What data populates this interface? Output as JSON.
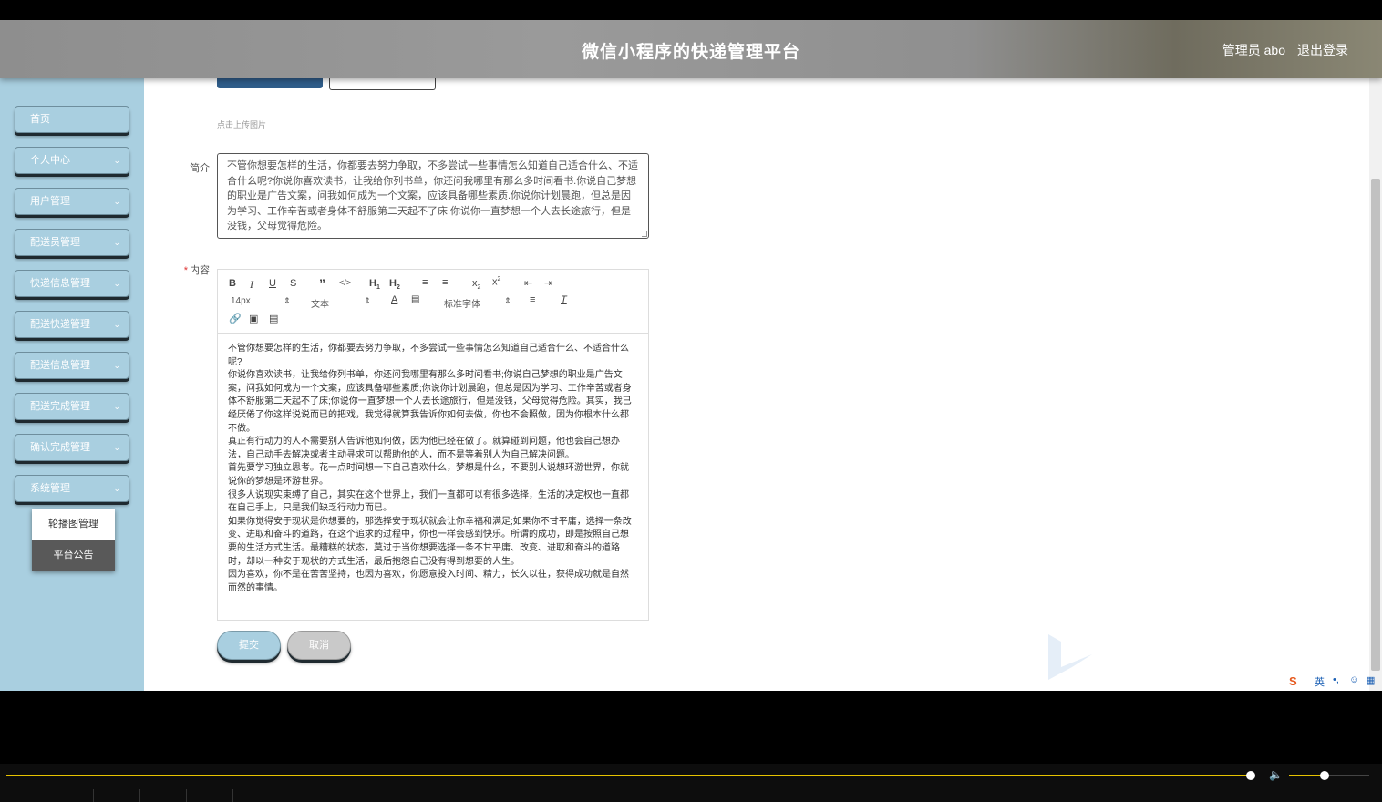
{
  "header": {
    "title": "微信小程序的快递管理平台",
    "user": "管理员 abo",
    "logout": "退出登录"
  },
  "sidebar": {
    "items": [
      {
        "label": "首页",
        "has_children": false
      },
      {
        "label": "个人中心",
        "has_children": true
      },
      {
        "label": "用户管理",
        "has_children": true
      },
      {
        "label": "配送员管理",
        "has_children": true
      },
      {
        "label": "快递信息管理",
        "has_children": true
      },
      {
        "label": "配送快递管理",
        "has_children": true
      },
      {
        "label": "配送信息管理",
        "has_children": true
      },
      {
        "label": "配送完成管理",
        "has_children": true
      },
      {
        "label": "确认完成管理",
        "has_children": true
      },
      {
        "label": "系统管理",
        "has_children": true
      }
    ],
    "submenu": [
      "轮播图管理",
      "平台公告"
    ],
    "submenu_active": "平台公告"
  },
  "form": {
    "upload_hint": "点击上传图片",
    "intro_label": "简介",
    "intro_text": "不管你想要怎样的生活，你都要去努力争取，不多尝试一些事情怎么知道自己适合什么、不适合什么呢?你说你喜欢读书，让我给你列书单，你还问我哪里有那么多时间看书.你说自己梦想的职业是广告文案，问我如何成为一个文案，应该具备哪些素质.你说你计划晨跑，但总是因为学习、工作辛苦或者身体不舒服第二天起不了床.你说你一直梦想一个人去长途旅行，但是没钱，父母觉得危险。",
    "content_label": "内容",
    "required_mark": "*",
    "toolbar": {
      "font_size": "14px",
      "block_type": "文本",
      "font_family": "标准字体"
    },
    "content_paragraphs": [
      "不管你想要怎样的生活，你都要去努力争取，不多尝试一些事情怎么知道自己适合什么、不适合什么呢?",
      "你说你喜欢读书，让我给你列书单，你还问我哪里有那么多时间看书;你说自己梦想的职业是广告文案，问我如何成为一个文案，应该具备哪些素质;你说你计划晨跑，但总是因为学习、工作辛苦或者身体不舒服第二天起不了床;你说你一直梦想一个人去长途旅行，但是没钱，父母觉得危险。其实，我已经厌倦了你这样说说而已的把戏，我觉得就算我告诉你如何去做，你也不会照做，因为你根本什么都不做。",
      "真正有行动力的人不需要别人告诉他如何做，因为他已经在做了。就算碰到问题，他也会自己想办法，自己动手去解决或者主动寻求可以帮助他的人，而不是等着别人为自己解决问题。",
      "首先要学习独立思考。花一点时间想一下自己喜欢什么，梦想是什么，不要别人说想环游世界，你就说你的梦想是环游世界。",
      "很多人说现实束缚了自己，其实在这个世界上，我们一直都可以有很多选择，生活的决定权也一直都在自己手上，只是我们缺乏行动力而已。",
      "如果你觉得安于现状是你想要的，那选择安于现状就会让你幸福和满足;如果你不甘平庸，选择一条改变、进取和奋斗的道路，在这个追求的过程中，你也一样会感到快乐。所谓的成功，即是按照自己想要的生活方式生活。最糟糕的状态，莫过于当你想要选择一条不甘平庸、改变、进取和奋斗的道路时，却以一种安于现状的方式生活，最后抱怨自己没有得到想要的人生。",
      "因为喜欢，你不是在苦苦坚持，也因为喜欢，你愿意投入时间、精力，长久以往，获得成功就是自然而然的事情。"
    ],
    "submit": "提交",
    "cancel": "取消"
  },
  "ime": {
    "lang": "英"
  }
}
